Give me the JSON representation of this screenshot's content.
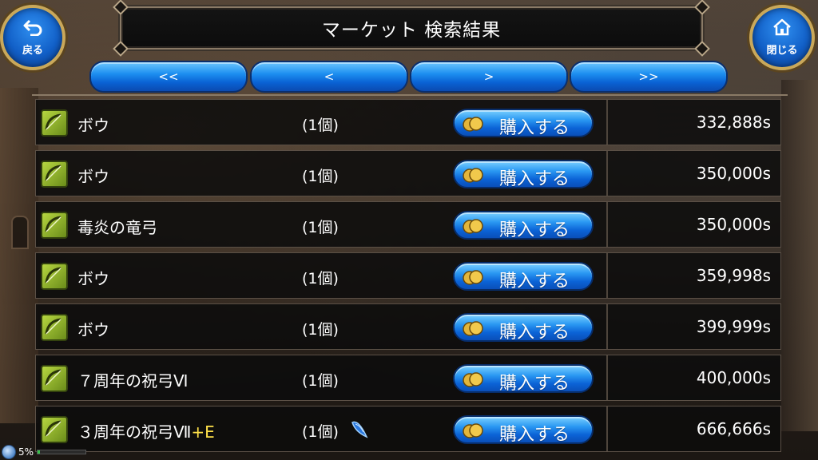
{
  "title": "マーケット 検索結果",
  "back_button": {
    "icon": "back-arrow-icon",
    "label": "戻る"
  },
  "close_button": {
    "icon": "home-icon",
    "label": "閉じる"
  },
  "pagination": {
    "first": "<<",
    "prev": "<",
    "next": ">",
    "last": ">>"
  },
  "items": [
    {
      "icon": "bow-icon",
      "name": "ボウ",
      "name_plus": "",
      "quantity": "(1個)",
      "buy_label": "購入する",
      "price": "332,888s",
      "has_gem": false
    },
    {
      "icon": "bow-icon",
      "name": "ボウ",
      "name_plus": "",
      "quantity": "(1個)",
      "buy_label": "購入する",
      "price": "350,000s",
      "has_gem": false
    },
    {
      "icon": "bow-icon",
      "name": "毒炎の竜弓",
      "name_plus": "",
      "quantity": "(1個)",
      "buy_label": "購入する",
      "price": "350,000s",
      "has_gem": false
    },
    {
      "icon": "bow-icon",
      "name": "ボウ",
      "name_plus": "",
      "quantity": "(1個)",
      "buy_label": "購入する",
      "price": "359,998s",
      "has_gem": false
    },
    {
      "icon": "bow-icon",
      "name": "ボウ",
      "name_plus": "",
      "quantity": "(1個)",
      "buy_label": "購入する",
      "price": "399,999s",
      "has_gem": false
    },
    {
      "icon": "bow-icon",
      "name": "７周年の祝弓Ⅵ",
      "name_plus": "",
      "quantity": "(1個)",
      "buy_label": "購入する",
      "price": "400,000s",
      "has_gem": false
    },
    {
      "icon": "bow-icon",
      "name": "３周年の祝弓Ⅶ",
      "name_plus": "+E",
      "quantity": "(1個)",
      "buy_label": "購入する",
      "price": "666,666s",
      "has_gem": true
    }
  ],
  "status": {
    "percent": "5%",
    "progress": 0.05
  },
  "colors": {
    "accent_blue": "#1d8ff0",
    "gold_frame": "#c9a85a",
    "item_icon_green": "#9cc232",
    "plus_yellow": "#ffe14a"
  }
}
